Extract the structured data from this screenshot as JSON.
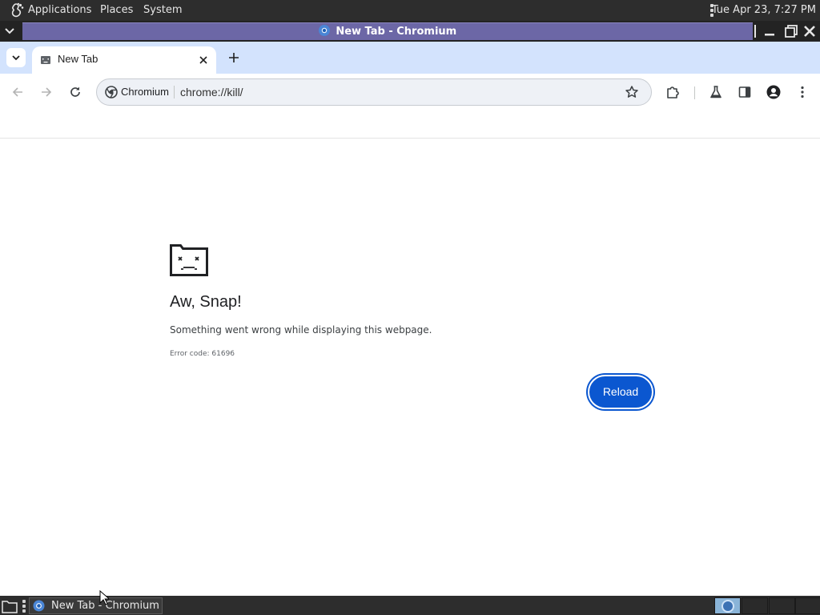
{
  "system_panel": {
    "menus": [
      "Applications",
      "Places",
      "System"
    ],
    "clock": "Tue Apr 23,  7:27 PM"
  },
  "window": {
    "title": "New Tab - Chromium"
  },
  "browser": {
    "tab": {
      "title": "New Tab"
    },
    "omnibox": {
      "chip_label": "Chromium",
      "url": "chrome://kill/"
    }
  },
  "error_page": {
    "title": "Aw, Snap!",
    "message": "Something went wrong while displaying this webpage.",
    "error_code": "Error code: 61696",
    "reload_label": "Reload"
  },
  "taskbar": {
    "task_label": "New Tab - Chromium",
    "workspaces": 4
  },
  "colors": {
    "accent": "#0b57d0",
    "tab_strip": "#d3e3fd",
    "title_bar_active": "#6c67a6",
    "panel": "#2d2d2d"
  },
  "icons": [
    "gnome-foot-icon",
    "window-menu-icon",
    "chromium-icon",
    "minimize-icon",
    "maximize-icon",
    "close-icon",
    "tab-search-icon",
    "sad-tab-favicon",
    "new-tab-icon",
    "back-icon",
    "forward-icon",
    "reload-icon",
    "chromium-chip-icon",
    "bookmark-star-icon",
    "extensions-icon",
    "labs-flask-icon",
    "side-panel-icon",
    "profile-icon",
    "kebab-menu-icon",
    "sad-folder-icon",
    "show-desktop-icon"
  ]
}
